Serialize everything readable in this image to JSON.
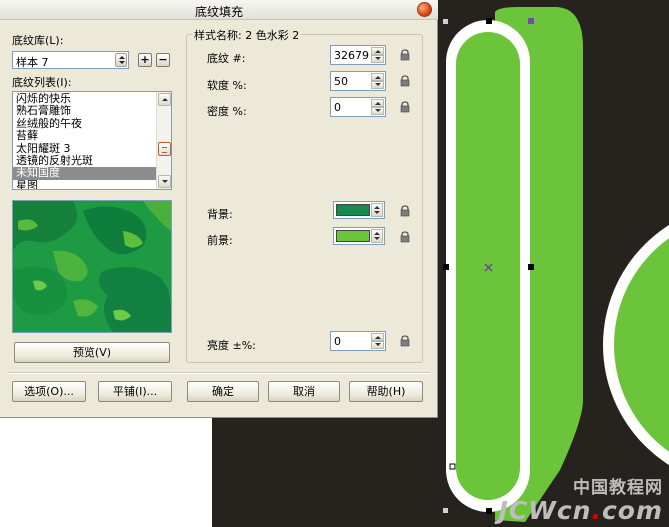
{
  "dialog": {
    "title": "底纹填充",
    "library_label": "底纹库(L):",
    "library_value": "样本 7",
    "add_label": "+",
    "remove_label": "−",
    "list_label": "底纹列表(I):",
    "list_items": [
      {
        "label": "闪烁的快乐",
        "selected": false
      },
      {
        "label": "熟石膏雕饰",
        "selected": false
      },
      {
        "label": "丝绒般的午夜",
        "selected": false
      },
      {
        "label": "苔藓",
        "selected": false
      },
      {
        "label": "太阳耀斑 3",
        "selected": false
      },
      {
        "label": "透镜的反射光斑",
        "selected": false
      },
      {
        "label": "未知国度",
        "selected": true
      },
      {
        "label": "星图",
        "selected": false
      }
    ],
    "preview_button": "预览(V)",
    "style_name_label": "样式名称: 2 色水彩 2",
    "params": {
      "texture_label": "底纹 #:",
      "texture_value": "32679",
      "softness_label": "软度 %:",
      "softness_value": "50",
      "density_label": "密度 %:",
      "density_value": "0",
      "background_label": "背景:",
      "background_color": "#148a4c",
      "foreground_label": "前景:",
      "foreground_color": "#6cc43a",
      "brightness_label": "亮度 ±%:",
      "brightness_value": "0"
    },
    "buttons": {
      "options": "选项(O)...",
      "tile": "平铺(I)...",
      "ok": "确定",
      "cancel": "取消",
      "help": "帮助(H)"
    }
  },
  "canvas": {
    "background_color": "#26221e",
    "shape_fill": "#6cc43a",
    "outline_color": "#ffffff",
    "watermark_cn": "中国教程网",
    "watermark_en_prefix": "JCWcn",
    "watermark_dot": ".",
    "watermark_en_suffix": "com"
  }
}
